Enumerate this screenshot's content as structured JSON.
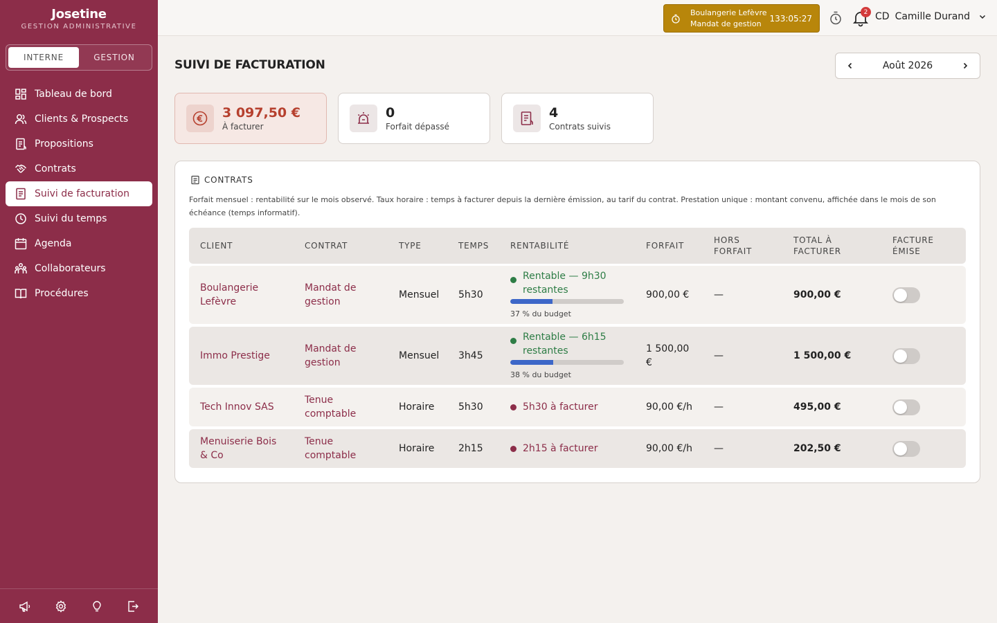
{
  "brand": {
    "name": "Josetine",
    "subtitle": "GESTION ADMINISTRATIVE"
  },
  "mode_switch": {
    "options": [
      "INTERNE",
      "GESTION"
    ],
    "active": "INTERNE"
  },
  "sidebar": {
    "items": [
      {
        "label": "Tableau de bord",
        "icon": "dashboard-icon"
      },
      {
        "label": "Clients & Prospects",
        "icon": "users-icon"
      },
      {
        "label": "Propositions",
        "icon": "document-icon"
      },
      {
        "label": "Contrats",
        "icon": "handshake-icon"
      },
      {
        "label": "Suivi de facturation",
        "icon": "invoice-icon",
        "active": true
      },
      {
        "label": "Suivi du temps",
        "icon": "clock-icon"
      },
      {
        "label": "Agenda",
        "icon": "calendar-icon"
      },
      {
        "label": "Collaborateurs",
        "icon": "team-icon"
      },
      {
        "label": "Procédures",
        "icon": "book-icon"
      }
    ],
    "footer_icons": [
      "megaphone-icon",
      "settings-icon",
      "lightbulb-icon",
      "logout-icon"
    ]
  },
  "topbar": {
    "timer": {
      "client": "Boulangerie Lefèvre",
      "contract": "Mandat de gestion",
      "elapsed": "133:05:27"
    },
    "notifications_count": "2",
    "user": {
      "initials": "CD",
      "name": "Camille Durand"
    }
  },
  "page": {
    "title": "SUIVI DE FACTURATION",
    "month": "Août 2026"
  },
  "kpis": [
    {
      "value": "3 097,50 €",
      "label": "À facturer",
      "icon": "euro-icon"
    },
    {
      "value": "0",
      "label": "Forfait dépassé",
      "icon": "alarm-icon"
    },
    {
      "value": "4",
      "label": "Contrats suivis",
      "icon": "contract-icon"
    }
  ],
  "contracts": {
    "heading": "CONTRATS",
    "description": "Forfait mensuel : rentabilité sur le mois observé. Taux horaire : temps à facturer depuis la dernière émission, au tarif du contrat. Prestation unique : montant convenu, affichée dans le mois de son échéance (temps informatif).",
    "columns": [
      "CLIENT",
      "CONTRAT",
      "TYPE",
      "TEMPS",
      "RENTABILITÉ",
      "FORFAIT",
      "HORS FORFAIT",
      "TOTAL À FACTURER",
      "FACTURE ÉMISE"
    ],
    "rows": [
      {
        "client": "Boulangerie Lefèvre",
        "contract": "Mandat de gestion",
        "type": "Mensuel",
        "time": "5h30",
        "profit": "Rentable — 9h30 restantes",
        "budget_pct": 37,
        "budget_label": "37 % du budget",
        "forfait": "900,00 €",
        "hors_forfait": "—",
        "total": "900,00 €",
        "invoiced": false
      },
      {
        "client": "Immo Prestige",
        "contract": "Mandat de gestion",
        "type": "Mensuel",
        "time": "3h45",
        "profit": "Rentable — 6h15 restantes",
        "budget_pct": 38,
        "budget_label": "38 % du budget",
        "forfait": "1 500,00 €",
        "hors_forfait": "—",
        "total": "1 500,00 €",
        "invoiced": false
      },
      {
        "client": "Tech Innov SAS",
        "contract": "Tenue comptable",
        "type": "Horaire",
        "time": "5h30",
        "profit": "5h30 à facturer",
        "forfait": "90,00 €/h",
        "hors_forfait": "—",
        "total": "495,00 €",
        "invoiced": false
      },
      {
        "client": "Menuiserie Bois & Co",
        "contract": "Tenue comptable",
        "type": "Horaire",
        "time": "2h15",
        "profit": "2h15 à facturer",
        "forfait": "90,00 €/h",
        "hors_forfait": "—",
        "total": "202,50 €",
        "invoiced": false
      }
    ]
  },
  "colors": {
    "sidebar": "#8c2d49",
    "accent": "#8c2d49",
    "timer": "#b8860b",
    "positive": "#2e7d46",
    "progress": "#3d67c8"
  }
}
